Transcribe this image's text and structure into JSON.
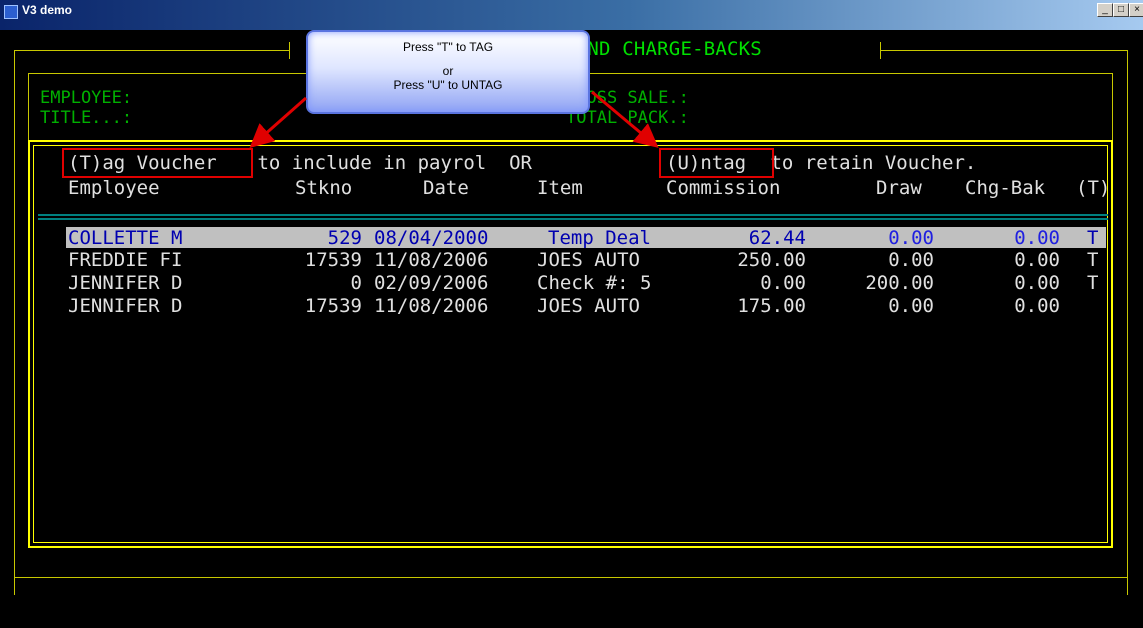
{
  "window": {
    "title": "V3 demo",
    "min": "_",
    "max": "□",
    "close": "×"
  },
  "screen": {
    "title": "UNPAID A/P COMMISSIONS AND CHARGE-BACKS",
    "employee_label": "EMPLOYEE:",
    "title_label": "TITLE...:",
    "gross_sale_label": "GROSS SALE.:",
    "total_pack_label": "TOTAL PACK.:"
  },
  "callout": {
    "line1": "Press \"T\" to TAG",
    "line2": "or",
    "line3": "Press \"U\" to UNTAG"
  },
  "instructions": {
    "tag": "(T)ag Voucher",
    "mid": " to include in payrol  OR  ",
    "untag": "(U)ntag",
    "end": " to retain Voucher."
  },
  "columns": {
    "employee": "Employee",
    "stkno": "Stkno",
    "date": "Date",
    "item": "Item",
    "commission": "Commission",
    "draw": "Draw",
    "chgbak": "Chg-Bak",
    "tag": "(T)"
  },
  "rows": [
    {
      "employee": "COLLETTE M",
      "stkno": "529",
      "date": "08/04/2000",
      "item": "Temp Deal",
      "commission": "62.44",
      "draw": "0.00",
      "chgbak": "0.00",
      "tag": "T"
    },
    {
      "employee": "FREDDIE FI",
      "stkno": "17539",
      "date": "11/08/2006",
      "item": "JOES AUTO",
      "commission": "250.00",
      "draw": "0.00",
      "chgbak": "0.00",
      "tag": "T"
    },
    {
      "employee": "JENNIFER D",
      "stkno": "0",
      "date": "02/09/2006",
      "item": "Check #: 5",
      "commission": "0.00",
      "draw": "200.00",
      "chgbak": "0.00",
      "tag": "T"
    },
    {
      "employee": "JENNIFER D",
      "stkno": "17539",
      "date": "11/08/2006",
      "item": "JOES AUTO",
      "commission": "175.00",
      "draw": "0.00",
      "chgbak": "0.00",
      "tag": ""
    }
  ],
  "colors": {
    "accent_green": "#00e000",
    "frame_yellow": "#ffff00",
    "highlight": "#c0c0c0",
    "annotation_red": "#e00000"
  }
}
